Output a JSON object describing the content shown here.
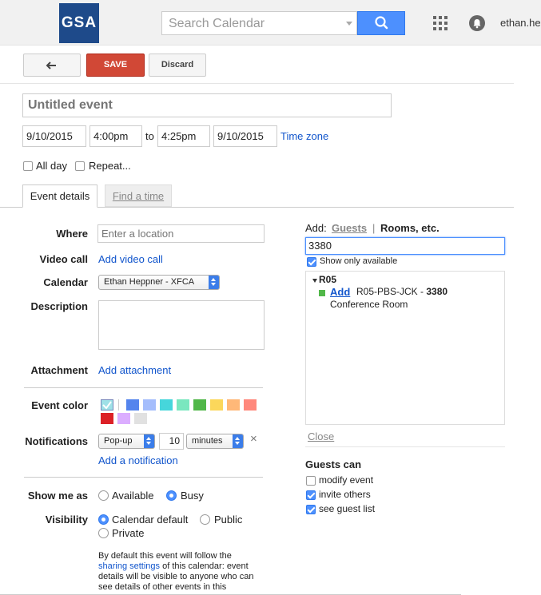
{
  "header": {
    "logo_text": "GSA",
    "search_placeholder": "Search Calendar",
    "user_name": "ethan.he"
  },
  "toolbar": {
    "save_label": "SAVE",
    "discard_label": "Discard"
  },
  "event": {
    "title_placeholder": "Untitled event",
    "start_date": "9/10/2015",
    "start_time": "4:00pm",
    "to_label": "to",
    "end_time": "4:25pm",
    "end_date": "9/10/2015",
    "time_zone_link": "Time zone",
    "all_day_label": "All day",
    "repeat_label": "Repeat..."
  },
  "tabs": [
    {
      "label": "Event details",
      "active": true
    },
    {
      "label": "Find a time",
      "active": false
    }
  ],
  "details": {
    "where_label": "Where",
    "where_placeholder": "Enter a location",
    "video_call_label": "Video call",
    "video_call_link": "Add video call",
    "calendar_label": "Calendar",
    "calendar_value": "Ethan Heppner - XFCA",
    "description_label": "Description",
    "attachment_label": "Attachment",
    "attachment_link": "Add attachment",
    "event_color_label": "Event color",
    "notifications_label": "Notifications",
    "notification_type": "Pop-up",
    "notification_value": "10",
    "notification_unit": "minutes",
    "notification_remove": "×",
    "add_notification_link": "Add a notification",
    "show_me_as_label": "Show me as",
    "available_label": "Available",
    "busy_label": "Busy",
    "visibility_label": "Visibility",
    "calendar_default_label": "Calendar default",
    "public_label": "Public",
    "private_label": "Private",
    "visibility_note_1": "By default this event will follow the",
    "visibility_note_link": "sharing settings",
    "visibility_note_2": " of this calendar: event",
    "visibility_note_3": "details will be visible to anyone who can",
    "visibility_note_4": "see details of other events in this"
  },
  "colors": {
    "accent": "#4d90fe",
    "save": "#d14836",
    "link": "#1155cc",
    "swatches_row1": [
      "#9fe1e7",
      "#5484ed",
      "#a4bdfc",
      "#46d6db",
      "#7ae7bf",
      "#51b749",
      "#fbd75b",
      "#ffb878",
      "#ff887c"
    ],
    "swatches_row2": [
      "#dc2127",
      "#dbadff",
      "#e1e1e1"
    ]
  },
  "guests_panel": {
    "add_label": "Add:",
    "guests_tab": "Guests",
    "separator": "|",
    "rooms_tab": "Rooms, etc.",
    "room_search_value": "3380",
    "show_only_available_label": "Show only available",
    "group_name": "R05",
    "room_add_link": "Add",
    "room_name": "R05-PBS-JCK - ",
    "room_number": "3380",
    "room_type": "Conference Room",
    "close_link": "Close",
    "guests_can_label": "Guests can",
    "modify_event_label": "modify event",
    "invite_others_label": "invite others",
    "see_guest_list_label": "see guest list"
  },
  "icons": {
    "back": "arrow-left-icon",
    "search": "search-icon",
    "apps": "apps-grid-icon",
    "notifications": "bell-icon"
  }
}
